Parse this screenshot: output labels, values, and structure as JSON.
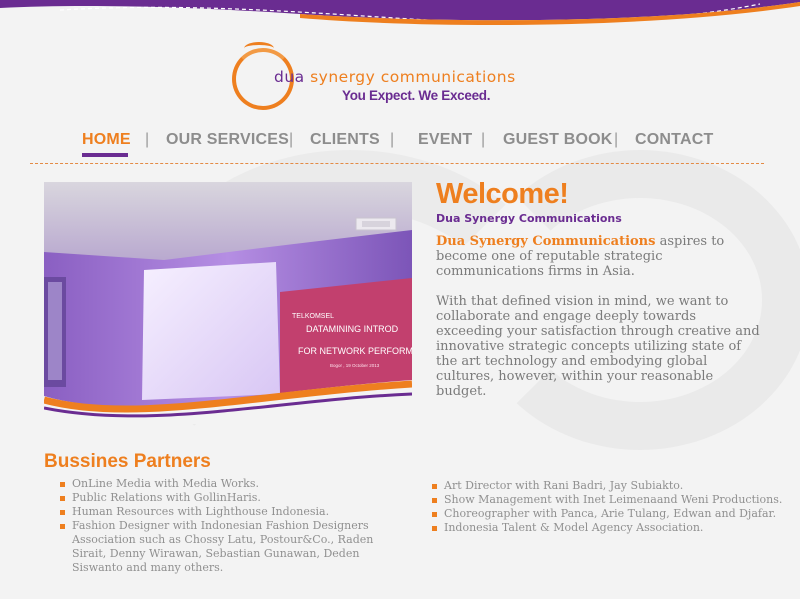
{
  "logo": {
    "name_prefix": "dua",
    "name_rest": " synergy communications",
    "tagline": "You Expect. We Exceed."
  },
  "nav": {
    "items": [
      "HOME",
      "OUR SERVICES",
      "CLIENTS",
      "EVENT",
      "GUEST BOOK",
      "CONTACT"
    ],
    "separator": "|",
    "active": "HOME"
  },
  "hero": {
    "banner_line1": "DATAMINING INTROD",
    "banner_line2": "FOR NETWORK PERFORMA",
    "banner_brand": "TELKOMSEL",
    "banner_small": "Bogor , 19 October 2013"
  },
  "welcome": {
    "title": "Welcome!",
    "subtitle": "Dua Synergy Communications",
    "p1_highlight": "Dua Synergy Communications",
    "p1_rest": " aspires to become one of reputable strategic communications firms in Asia.",
    "p2": "With that defined vision in mind, we want to collaborate and engage deeply towards exceeding your satisfaction through creative and innovative strategic concepts utilizing state of the art technology and embodying global cultures, however, within your reasonable budget."
  },
  "partners": {
    "title": "Bussines Partners",
    "left": [
      "OnLine Media with Media Works.",
      "Public Relations with GollinHaris.",
      "Human Resources with Lighthouse Indonesia.",
      "Fashion Designer with Indonesian Fashion Designers Association such as Chossy Latu, Postour&Co., Raden Sirait, Denny Wirawan, Sebastian Gunawan, Deden Siswanto and many others."
    ],
    "right": [
      "Art Director with Rani Badri, Jay Subiakto.",
      "Show Management with Inet Leimenaand Weni Productions.",
      "Choreographer with Panca, Arie Tulang, Edwan and Djafar.",
      "Indonesia Talent & Model Agency Association."
    ]
  },
  "colors": {
    "orange": "#ee7f1f",
    "purple": "#6a2c91",
    "text_gray": "#7a7a7a"
  }
}
